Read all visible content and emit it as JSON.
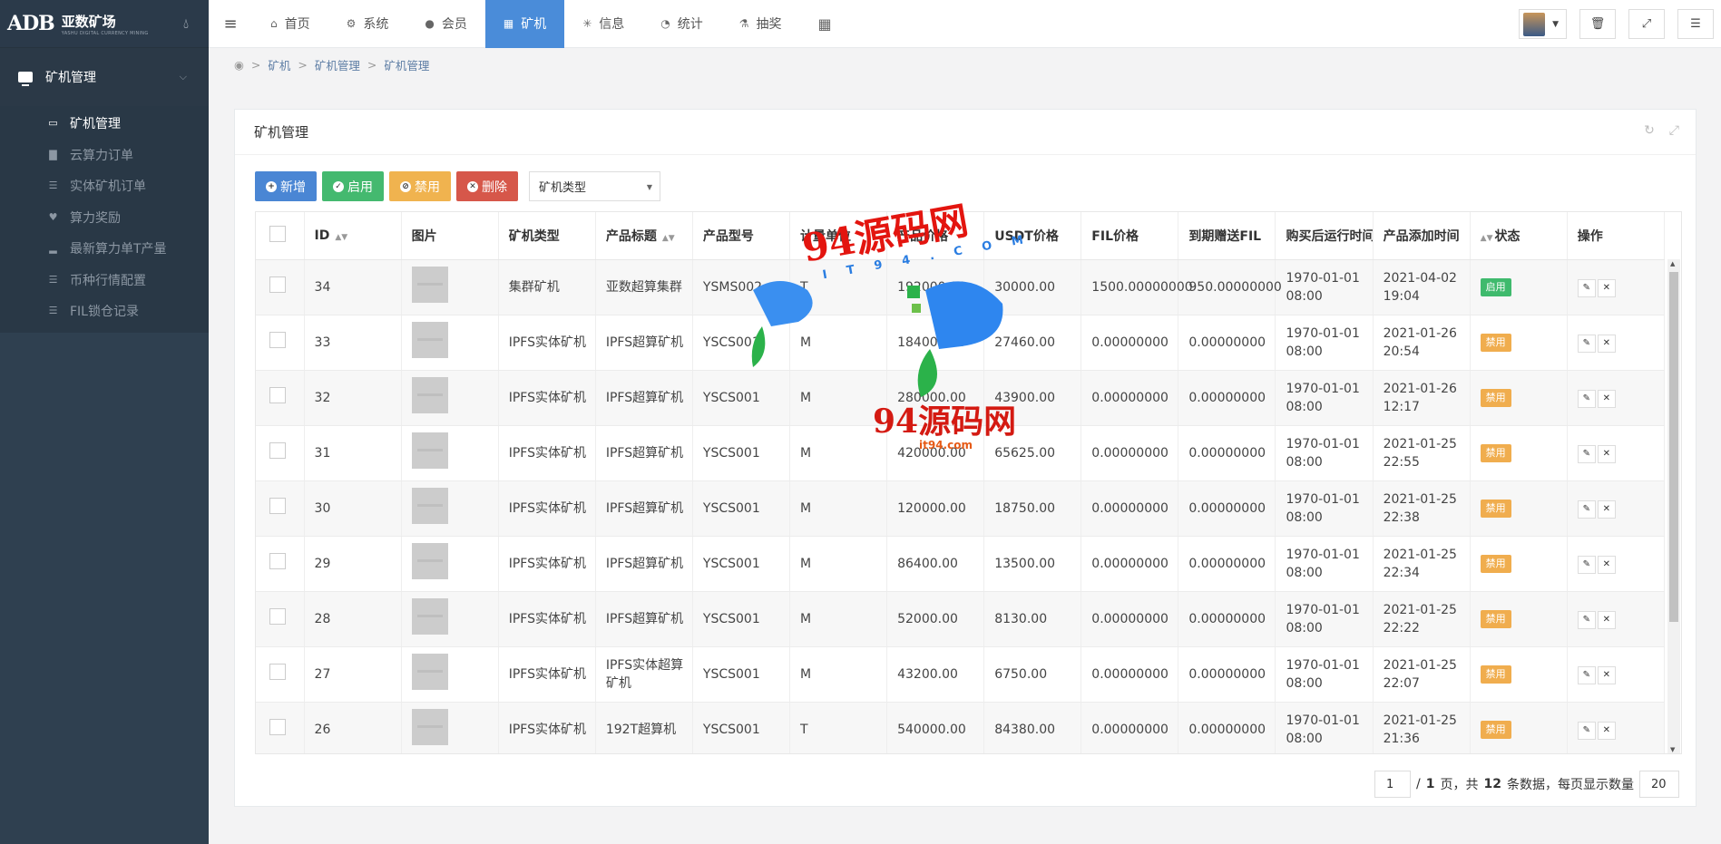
{
  "brand": {
    "name": "亚数矿场",
    "subtitle": "YASHU DIGITAL CURRENCY MINING",
    "mark": "ADB"
  },
  "sidebar": {
    "group_label": "矿机管理",
    "items": [
      {
        "label": "矿机管理",
        "icon": "monitor-icon",
        "active": true
      },
      {
        "label": "云算力订单",
        "icon": "bar-chart-icon",
        "active": false
      },
      {
        "label": "实体矿机订单",
        "icon": "list-icon",
        "active": false
      },
      {
        "label": "算力奖励",
        "icon": "heart-icon",
        "active": false
      },
      {
        "label": "最新算力单T产量",
        "icon": "signal-icon",
        "active": false
      },
      {
        "label": "币种行情配置",
        "icon": "list-icon",
        "active": false
      },
      {
        "label": "FIL锁仓记录",
        "icon": "list-icon",
        "active": false
      }
    ]
  },
  "topnav": {
    "tabs": [
      {
        "label": "首页",
        "icon": "home-icon",
        "active": false
      },
      {
        "label": "系统",
        "icon": "gear-icon",
        "active": false
      },
      {
        "label": "会员",
        "icon": "user-icon",
        "active": false
      },
      {
        "label": "矿机",
        "icon": "windows-icon",
        "active": true
      },
      {
        "label": "信息",
        "icon": "share-icon",
        "active": false
      },
      {
        "label": "统计",
        "icon": "pie-chart-icon",
        "active": false
      },
      {
        "label": "抽奖",
        "icon": "flask-icon",
        "active": false
      }
    ]
  },
  "breadcrumb": [
    "矿机",
    "矿机管理",
    "矿机管理"
  ],
  "panel": {
    "title": "矿机管理"
  },
  "toolbar": {
    "add_label": "新增",
    "enable_label": "启用",
    "disable_label": "禁用",
    "delete_label": "删除",
    "type_select_value": "矿机类型"
  },
  "table": {
    "headers": [
      "ID",
      "图片",
      "矿机类型",
      "产品标题",
      "产品型号",
      "计量单位",
      "产品价格",
      "USDT价格",
      "FIL价格",
      "到期赠送FIL",
      "购买后运行时间",
      "产品添加时间",
      "状态",
      "操作"
    ],
    "rows": [
      {
        "id": "34",
        "type": "集群矿机",
        "title": "亚数超算集群",
        "model": "YSMS002",
        "unit": "T",
        "price": "192000.00",
        "usdt": "30000.00",
        "fil": "1500.00000000",
        "gift": "950.00000000",
        "run_time": "1970-01-01 08:00",
        "added": "2021-04-02 19:04",
        "status": "启用",
        "status_kind": "on"
      },
      {
        "id": "33",
        "type": "IPFS实体矿机",
        "title": "IPFS超算矿机",
        "model": "YSCS001",
        "unit": "M",
        "price": "184000.00",
        "usdt": "27460.00",
        "fil": "0.00000000",
        "gift": "0.00000000",
        "run_time": "1970-01-01 08:00",
        "added": "2021-01-26 20:54",
        "status": "禁用",
        "status_kind": "off"
      },
      {
        "id": "32",
        "type": "IPFS实体矿机",
        "title": "IPFS超算矿机",
        "model": "YSCS001",
        "unit": "M",
        "price": "280000.00",
        "usdt": "43900.00",
        "fil": "0.00000000",
        "gift": "0.00000000",
        "run_time": "1970-01-01 08:00",
        "added": "2021-01-26 12:17",
        "status": "禁用",
        "status_kind": "off"
      },
      {
        "id": "31",
        "type": "IPFS实体矿机",
        "title": "IPFS超算矿机",
        "model": "YSCS001",
        "unit": "M",
        "price": "420000.00",
        "usdt": "65625.00",
        "fil": "0.00000000",
        "gift": "0.00000000",
        "run_time": "1970-01-01 08:00",
        "added": "2021-01-25 22:55",
        "status": "禁用",
        "status_kind": "off"
      },
      {
        "id": "30",
        "type": "IPFS实体矿机",
        "title": "IPFS超算矿机",
        "model": "YSCS001",
        "unit": "M",
        "price": "120000.00",
        "usdt": "18750.00",
        "fil": "0.00000000",
        "gift": "0.00000000",
        "run_time": "1970-01-01 08:00",
        "added": "2021-01-25 22:38",
        "status": "禁用",
        "status_kind": "off"
      },
      {
        "id": "29",
        "type": "IPFS实体矿机",
        "title": "IPFS超算矿机",
        "model": "YSCS001",
        "unit": "M",
        "price": "86400.00",
        "usdt": "13500.00",
        "fil": "0.00000000",
        "gift": "0.00000000",
        "run_time": "1970-01-01 08:00",
        "added": "2021-01-25 22:34",
        "status": "禁用",
        "status_kind": "off"
      },
      {
        "id": "28",
        "type": "IPFS实体矿机",
        "title": "IPFS超算矿机",
        "model": "YSCS001",
        "unit": "M",
        "price": "52000.00",
        "usdt": "8130.00",
        "fil": "0.00000000",
        "gift": "0.00000000",
        "run_time": "1970-01-01 08:00",
        "added": "2021-01-25 22:22",
        "status": "禁用",
        "status_kind": "off"
      },
      {
        "id": "27",
        "type": "IPFS实体矿机",
        "title": "IPFS实体超算矿机",
        "model": "YSCS001",
        "unit": "M",
        "price": "43200.00",
        "usdt": "6750.00",
        "fil": "0.00000000",
        "gift": "0.00000000",
        "run_time": "1970-01-01 08:00",
        "added": "2021-01-25 22:07",
        "status": "禁用",
        "status_kind": "off"
      },
      {
        "id": "26",
        "type": "IPFS实体矿机",
        "title": "192T超算机",
        "model": "YSCS001",
        "unit": "T",
        "price": "540000.00",
        "usdt": "84380.00",
        "fil": "0.00000000",
        "gift": "0.00000000",
        "run_time": "1970-01-01 08:00",
        "added": "2021-01-25 21:36",
        "status": "禁用",
        "status_kind": "off"
      }
    ]
  },
  "pager": {
    "current_page": "1",
    "page_sep": "/",
    "total_pages": "1",
    "page_suffix": "页，共",
    "total_count": "12",
    "count_suffix": "条数据，每页显示数量",
    "page_size": "20"
  },
  "watermark": {
    "main": "94源码网",
    "domain": "IT94.COM",
    "secondary": "94源码网",
    "secondary_domain": "it94.com"
  },
  "colors": {
    "sidebar_bg": "#2f4050",
    "nav_active": "#4a8cd9",
    "primary": "#4a86d4",
    "success": "#44b96f",
    "warning": "#f0b34f",
    "danger": "#d6574a"
  }
}
